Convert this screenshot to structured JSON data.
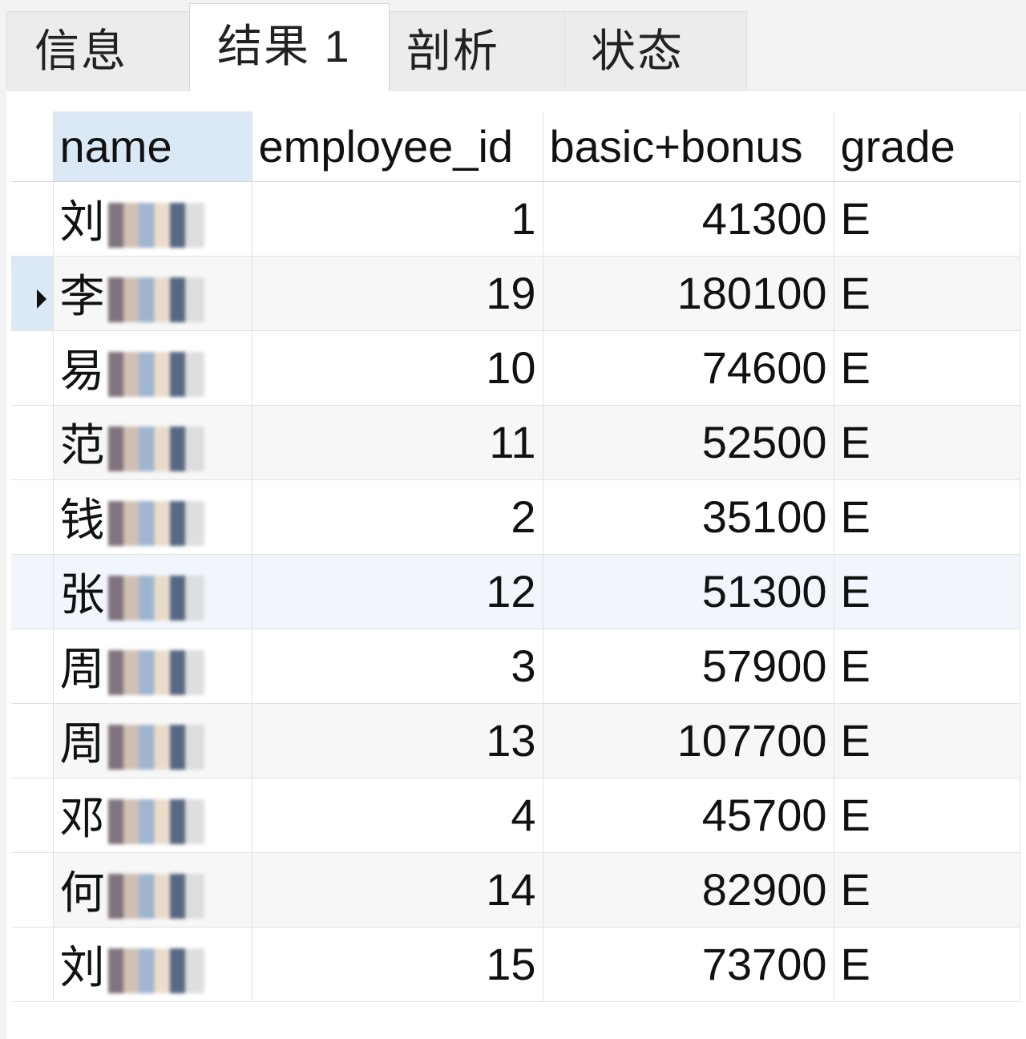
{
  "tabs": [
    {
      "label": "信息",
      "active": false
    },
    {
      "label": "结果 1",
      "active": true
    },
    {
      "label": "剖析",
      "active": false
    },
    {
      "label": "状态",
      "active": false
    }
  ],
  "columns": [
    "name",
    "employee_id",
    "basic+bonus",
    "grade"
  ],
  "rows": [
    {
      "name": "刘",
      "employee_id": "1",
      "salary": "41300",
      "grade": "E"
    },
    {
      "name": "李",
      "employee_id": "19",
      "salary": "180100",
      "grade": "E"
    },
    {
      "name": "易",
      "employee_id": "10",
      "salary": "74600",
      "grade": "E"
    },
    {
      "name": "范",
      "employee_id": "11",
      "salary": "52500",
      "grade": "E"
    },
    {
      "name": "钱",
      "employee_id": "2",
      "salary": "35100",
      "grade": "E"
    },
    {
      "name": "张",
      "employee_id": "12",
      "salary": "51300",
      "grade": "E"
    },
    {
      "name": "周",
      "employee_id": "3",
      "salary": "57900",
      "grade": "E"
    },
    {
      "name": "周",
      "employee_id": "13",
      "salary": "107700",
      "grade": "E"
    },
    {
      "name": "邓",
      "employee_id": "4",
      "salary": "45700",
      "grade": "E"
    },
    {
      "name": "何",
      "employee_id": "14",
      "salary": "82900",
      "grade": "E"
    },
    {
      "name": "刘",
      "employee_id": "15",
      "salary": "73700",
      "grade": "E"
    }
  ],
  "selected_row_index": 1
}
